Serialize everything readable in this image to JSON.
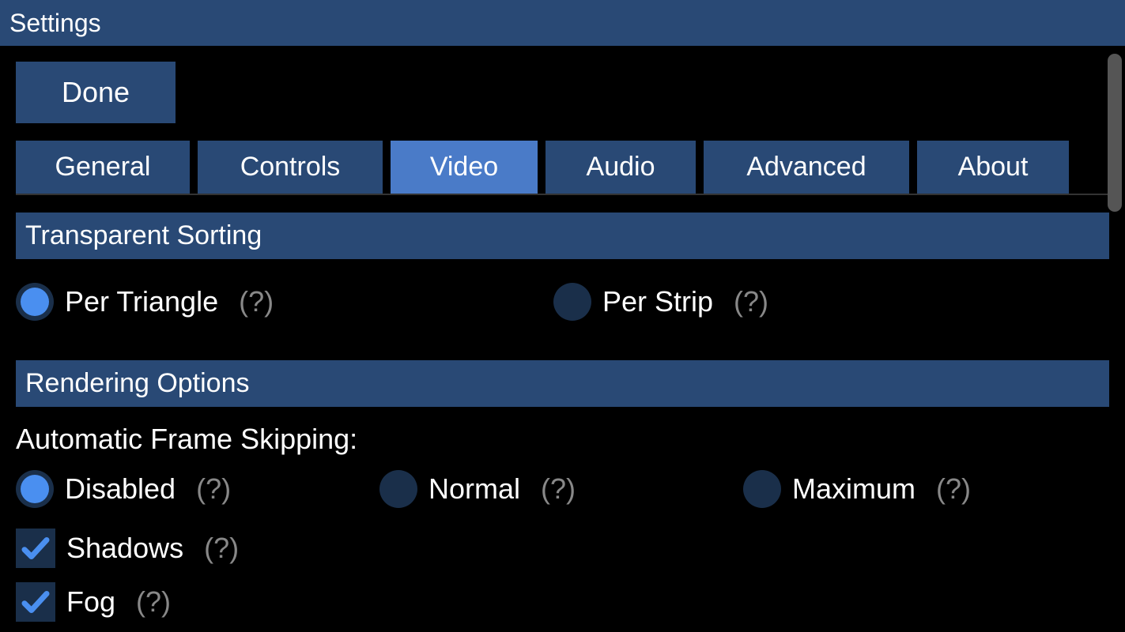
{
  "header": {
    "title": "Settings"
  },
  "done_label": "Done",
  "tabs": [
    {
      "label": "General",
      "active": false
    },
    {
      "label": "Controls",
      "active": false
    },
    {
      "label": "Video",
      "active": true
    },
    {
      "label": "Audio",
      "active": false
    },
    {
      "label": "Advanced",
      "active": false
    },
    {
      "label": "About",
      "active": false
    }
  ],
  "sections": {
    "transparent_sorting": {
      "title": "Transparent Sorting",
      "options": [
        {
          "label": "Per Triangle",
          "help": "(?)",
          "checked": true
        },
        {
          "label": "Per Strip",
          "help": "(?)",
          "checked": false
        }
      ]
    },
    "rendering_options": {
      "title": "Rendering Options",
      "frame_skipping": {
        "label": "Automatic Frame Skipping:",
        "options": [
          {
            "label": "Disabled",
            "help": "(?)",
            "checked": true
          },
          {
            "label": "Normal",
            "help": "(?)",
            "checked": false
          },
          {
            "label": "Maximum",
            "help": "(?)",
            "checked": false
          }
        ]
      },
      "checkboxes": [
        {
          "label": "Shadows",
          "help": "(?)",
          "checked": true
        },
        {
          "label": "Fog",
          "help": "(?)",
          "checked": true
        }
      ]
    }
  }
}
